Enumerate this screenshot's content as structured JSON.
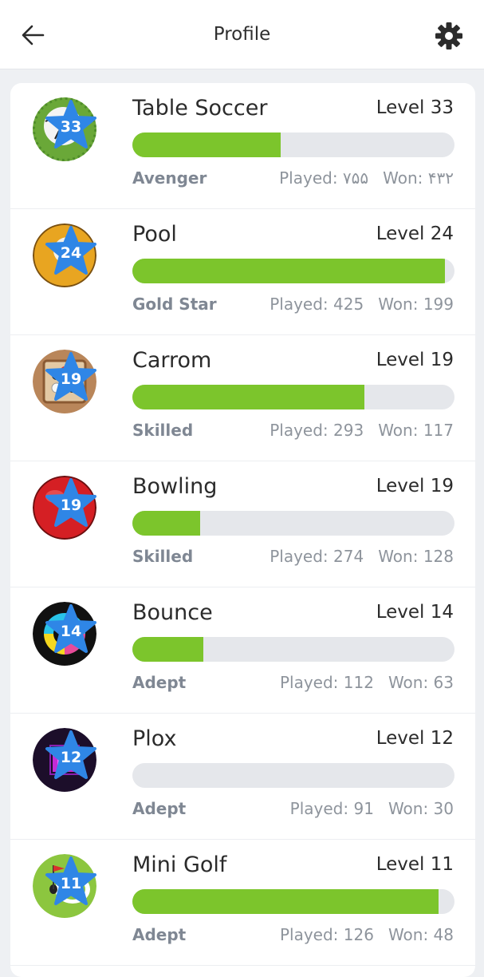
{
  "header": {
    "title": "Profile",
    "back_icon": "back-arrow-icon",
    "settings_icon": "gear-icon"
  },
  "colors": {
    "progress": "#7cc52c",
    "track": "#e5e7eb",
    "star": "#2f86e6"
  },
  "games": [
    {
      "name": "Table Soccer",
      "level_label": "Level 33",
      "star": "33",
      "rank": "Avenger",
      "played": "Played: ۷۵۵",
      "won": "Won: ۴۳۲",
      "progress": 0.46,
      "icon": "soccer-ball-icon"
    },
    {
      "name": "Pool",
      "level_label": "Level 24",
      "star": "24",
      "rank": "Gold Star",
      "played": "Played: 425",
      "won": "Won: 199",
      "progress": 0.97,
      "icon": "pool-ball-icon"
    },
    {
      "name": "Carrom",
      "level_label": "Level 19",
      "star": "19",
      "rank": "Skilled",
      "played": "Played: 293",
      "won": "Won: 117",
      "progress": 0.72,
      "icon": "carrom-board-icon"
    },
    {
      "name": "Bowling",
      "level_label": "Level 19",
      "star": "19",
      "rank": "Skilled",
      "played": "Played: 274",
      "won": "Won: 128",
      "progress": 0.21,
      "icon": "bowling-ball-icon"
    },
    {
      "name": "Bounce",
      "level_label": "Level 14",
      "star": "14",
      "rank": "Adept",
      "played": "Played: 112",
      "won": "Won: 63",
      "progress": 0.22,
      "icon": "bounce-ring-icon"
    },
    {
      "name": "Plox",
      "level_label": "Level 12",
      "star": "12",
      "rank": "Adept",
      "played": "Played: 91",
      "won": "Won: 30",
      "progress": 0.0,
      "icon": "plox-square-icon"
    },
    {
      "name": "Mini Golf",
      "level_label": "Level 11",
      "star": "11",
      "rank": "Adept",
      "played": "Played: 126",
      "won": "Won: 48",
      "progress": 0.95,
      "icon": "mini-golf-icon"
    }
  ]
}
